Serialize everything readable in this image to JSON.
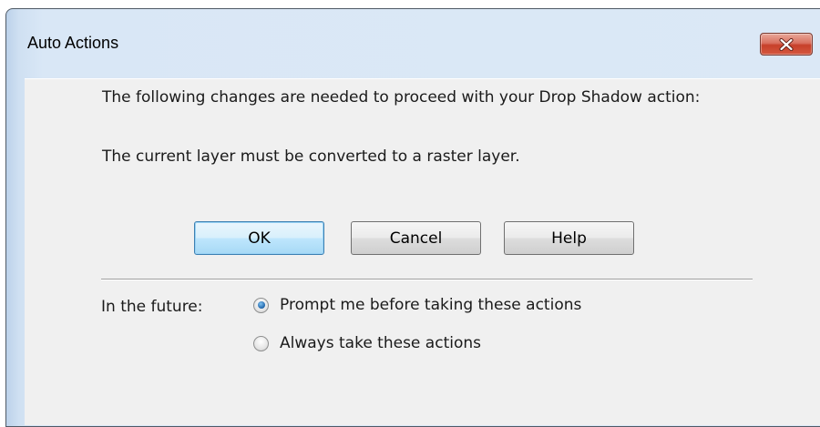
{
  "window": {
    "title": "Auto Actions"
  },
  "titlebar": {
    "close_icon": "close-icon",
    "close_color": "#c7402a"
  },
  "message": {
    "line1": "The following changes are needed to proceed with your Drop Shadow action:",
    "line2": "The current layer must be converted to a raster layer."
  },
  "buttons": {
    "ok": "OK",
    "cancel": "Cancel",
    "help": "Help"
  },
  "future": {
    "label": "In the future:",
    "options": [
      {
        "label": "Prompt me before taking these actions",
        "selected": true
      },
      {
        "label": "Always take these actions",
        "selected": false
      }
    ]
  }
}
